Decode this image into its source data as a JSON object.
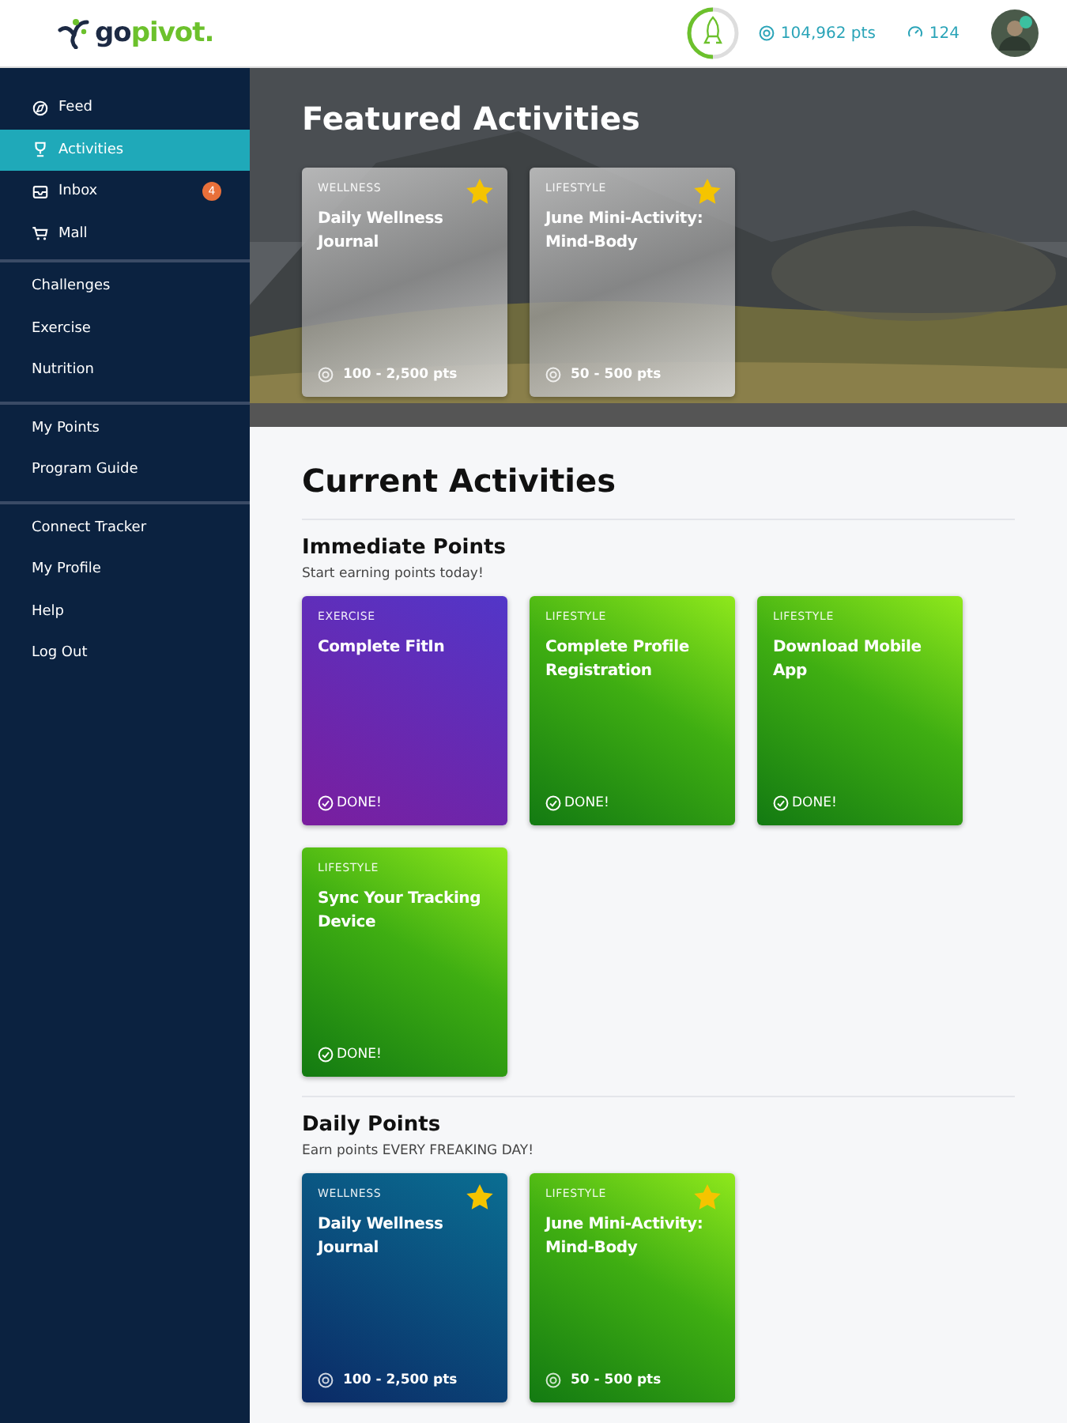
{
  "header": {
    "logo": [
      "go",
      "pivot."
    ],
    "progress": {
      "level": 0.5
    },
    "points": "104,962 pts",
    "streak": "124"
  },
  "sidebar": {
    "groups": [
      {
        "items": [
          {
            "label": "Feed",
            "kind": "compass",
            "selected": false
          },
          {
            "label": "Activities",
            "kind": "trophy",
            "selected": true
          },
          {
            "label": "Inbox",
            "kind": "inbox",
            "selected": false,
            "badge": "4"
          },
          {
            "label": "Mall",
            "kind": "cart",
            "selected": false
          }
        ]
      },
      {
        "items": [
          {
            "label": "Challenges",
            "selected": false
          },
          {
            "label": "Exercise",
            "selected": false
          },
          {
            "label": "Nutrition",
            "selected": false
          }
        ]
      },
      {
        "items": [
          {
            "label": "My Points",
            "selected": false
          },
          {
            "label": "Program Guide",
            "selected": false
          }
        ]
      },
      {
        "items": [
          {
            "label": "Connect Tracker",
            "selected": false
          },
          {
            "label": "My Profile",
            "selected": false
          },
          {
            "label": "Help",
            "selected": false
          },
          {
            "label": "Log Out",
            "selected": false
          }
        ]
      }
    ]
  },
  "featured": {
    "title": "Featured Activities",
    "cards": [
      {
        "kind": "glass",
        "category": "WELLNESS",
        "title": "Daily Wellness Journal",
        "starred": true,
        "points": "100 - 2,500 pts"
      },
      {
        "kind": "glass",
        "category": "LIFESTYLE",
        "title": "June Mini-Activity: Mind-Body",
        "starred": true,
        "points": "50 - 500 pts"
      }
    ]
  },
  "current": {
    "title": "Current Activities",
    "sections": [
      {
        "title": "Immediate Points",
        "subtitle": "Start earning points today!",
        "cards": [
          {
            "kind": "purple",
            "category": "EXERCISE",
            "title": "Complete FitIn",
            "starred": false,
            "status": "DONE!"
          },
          {
            "kind": "green",
            "category": "LIFESTYLE",
            "title": "Complete Profile Registration",
            "starred": false,
            "status": "DONE!"
          },
          {
            "kind": "green",
            "category": "LIFESTYLE",
            "title": "Download Mobile App",
            "starred": false,
            "status": "DONE!"
          },
          {
            "kind": "green",
            "category": "LIFESTYLE",
            "title": "Sync Your Tracking Device",
            "starred": false,
            "status": "DONE!"
          }
        ]
      },
      {
        "title": "Daily Points",
        "subtitle": "Earn points EVERY FREAKING DAY!",
        "cards": [
          {
            "kind": "blue",
            "category": "WELLNESS",
            "title": "Daily Wellness Journal",
            "starred": true,
            "points": "100 - 2,500 pts"
          },
          {
            "kind": "green",
            "category": "LIFESTYLE",
            "title": "June Mini-Activity: Mind-Body",
            "starred": true,
            "points": "50 - 500 pts"
          }
        ]
      }
    ]
  }
}
